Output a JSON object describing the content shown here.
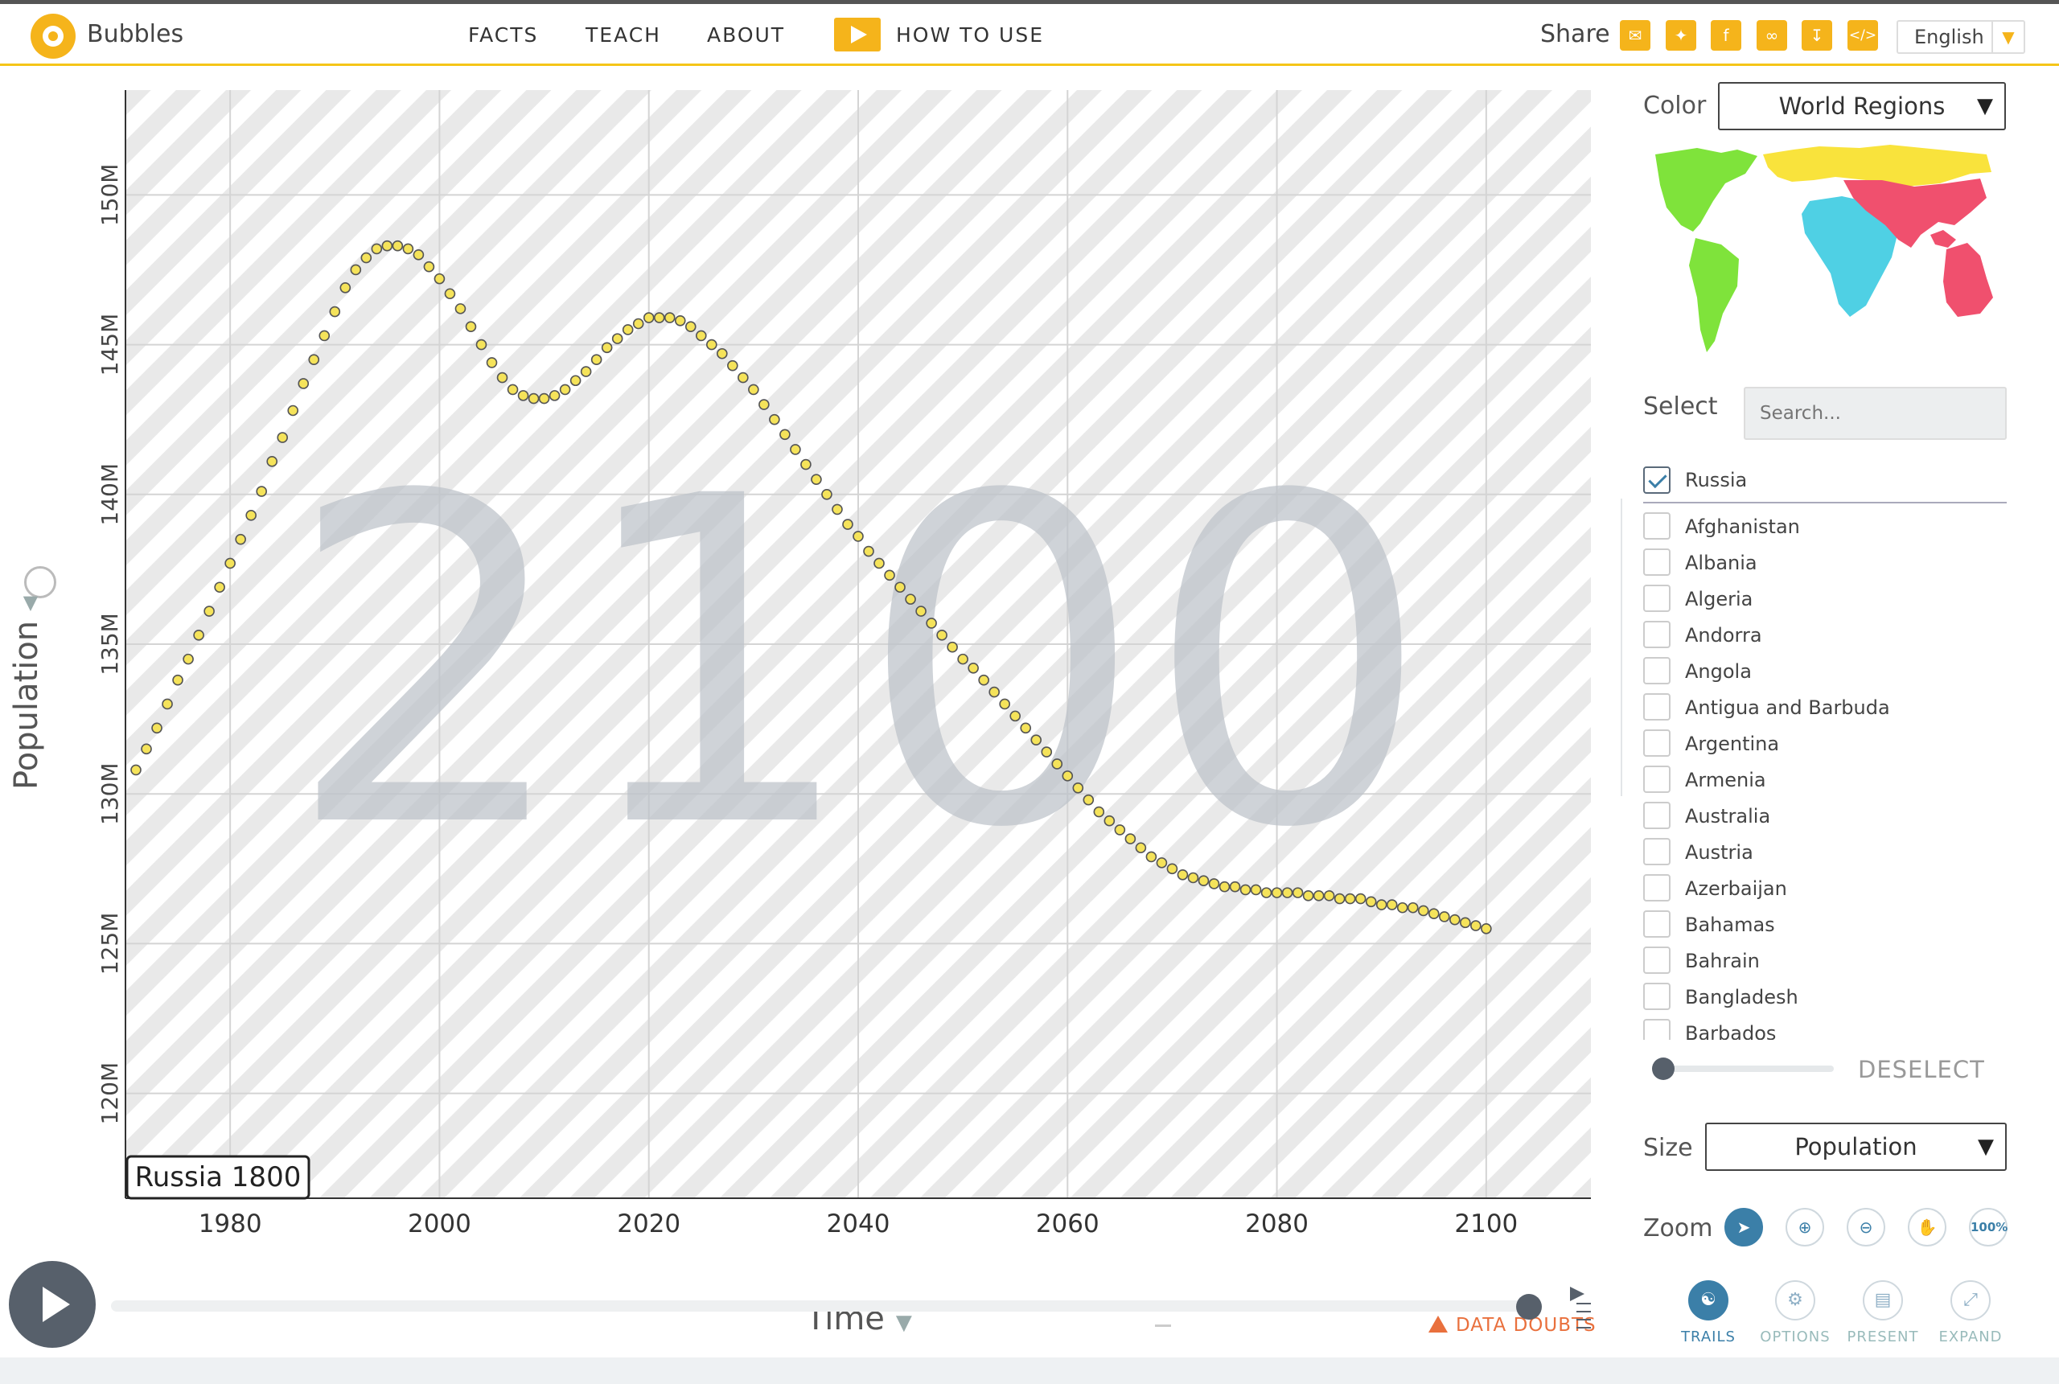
{
  "header": {
    "app_title": "Bubbles",
    "nav": [
      "FACTS",
      "TEACH",
      "ABOUT"
    ],
    "how_to_use": "HOW TO USE",
    "share_label": "Share",
    "share_icons": [
      "mail-icon",
      "twitter-icon",
      "facebook-icon",
      "link-icon",
      "download-icon",
      "embed-icon"
    ],
    "language": "English"
  },
  "chart": {
    "y_axis_label": "Population",
    "x_axis_label": "Time",
    "year_watermark": "2100",
    "tooltip_label": "Russia 1800",
    "data_doubts": "DATA DOUBTS"
  },
  "chart_data": {
    "type": "scatter",
    "title": "",
    "xlabel": "Time",
    "ylabel": "Population",
    "xlim": [
      1970,
      2110
    ],
    "ylim": [
      116500000,
      153500000
    ],
    "x_ticks": [
      1980,
      2000,
      2020,
      2040,
      2060,
      2080,
      2100
    ],
    "x_tick_labels": [
      "1980",
      "2000",
      "2020",
      "2040",
      "2060",
      "2080",
      "2100"
    ],
    "y_ticks": [
      120000000,
      125000000,
      130000000,
      135000000,
      140000000,
      145000000,
      150000000
    ],
    "y_tick_labels": [
      "120M",
      "125M",
      "130M",
      "135M",
      "140M",
      "145M",
      "150M"
    ],
    "grid": true,
    "series": [
      {
        "name": "Russia",
        "color": "#f5e35a",
        "stroke": "#555555",
        "x": [
          1971,
          1972,
          1973,
          1974,
          1975,
          1976,
          1977,
          1978,
          1979,
          1980,
          1981,
          1982,
          1983,
          1984,
          1985,
          1986,
          1987,
          1988,
          1989,
          1990,
          1991,
          1992,
          1993,
          1994,
          1995,
          1996,
          1997,
          1998,
          1999,
          2000,
          2001,
          2002,
          2003,
          2004,
          2005,
          2006,
          2007,
          2008,
          2009,
          2010,
          2011,
          2012,
          2013,
          2014,
          2015,
          2016,
          2017,
          2018,
          2019,
          2020,
          2021,
          2022,
          2023,
          2024,
          2025,
          2026,
          2027,
          2028,
          2029,
          2030,
          2031,
          2032,
          2033,
          2034,
          2035,
          2036,
          2037,
          2038,
          2039,
          2040,
          2041,
          2042,
          2043,
          2044,
          2045,
          2046,
          2047,
          2048,
          2049,
          2050,
          2051,
          2052,
          2053,
          2054,
          2055,
          2056,
          2057,
          2058,
          2059,
          2060,
          2061,
          2062,
          2063,
          2064,
          2065,
          2066,
          2067,
          2068,
          2069,
          2070,
          2071,
          2072,
          2073,
          2074,
          2075,
          2076,
          2077,
          2078,
          2079,
          2080,
          2081,
          2082,
          2083,
          2084,
          2085,
          2086,
          2087,
          2088,
          2089,
          2090,
          2091,
          2092,
          2093,
          2094,
          2095,
          2096,
          2097,
          2098,
          2099,
          2100
        ],
        "y": [
          130800000,
          131500000,
          132200000,
          133000000,
          133800000,
          134500000,
          135300000,
          136100000,
          136900000,
          137700000,
          138500000,
          139300000,
          140100000,
          141100000,
          141900000,
          142800000,
          143700000,
          144500000,
          145300000,
          146100000,
          146900000,
          147500000,
          147900000,
          148200000,
          148300000,
          148300000,
          148200000,
          148000000,
          147600000,
          147200000,
          146700000,
          146200000,
          145600000,
          145000000,
          144400000,
          143900000,
          143500000,
          143300000,
          143200000,
          143200000,
          143300000,
          143500000,
          143800000,
          144100000,
          144500000,
          144900000,
          145200000,
          145500000,
          145700000,
          145900000,
          145900000,
          145900000,
          145800000,
          145600000,
          145300000,
          145000000,
          144700000,
          144300000,
          143900000,
          143500000,
          143000000,
          142500000,
          142000000,
          141500000,
          141000000,
          140500000,
          140000000,
          139500000,
          139000000,
          138600000,
          138100000,
          137700000,
          137300000,
          136900000,
          136500000,
          136100000,
          135700000,
          135300000,
          134900000,
          134500000,
          134200000,
          133800000,
          133400000,
          133000000,
          132600000,
          132200000,
          131800000,
          131400000,
          131000000,
          130600000,
          130200000,
          129800000,
          129400000,
          129100000,
          128800000,
          128500000,
          128200000,
          127900000,
          127700000,
          127500000,
          127300000,
          127200000,
          127100000,
          127000000,
          126900000,
          126900000,
          126800000,
          126800000,
          126700000,
          126700000,
          126700000,
          126700000,
          126600000,
          126600000,
          126600000,
          126500000,
          126500000,
          126500000,
          126400000,
          126300000,
          126300000,
          126200000,
          126200000,
          126100000,
          126000000,
          125900000,
          125800000,
          125700000,
          125600000,
          125500000
        ]
      }
    ]
  },
  "timeline": {
    "play": "play-icon"
  },
  "panel": {
    "color_label": "Color",
    "color_value": "World Regions",
    "map_colors": {
      "americas": "#7fe33b",
      "europe_n_asia": "#f9e33c",
      "africa": "#4fd0e4",
      "asia_south": "#f0506e",
      "oceania": "#f0506e"
    },
    "select_label": "Select",
    "search_placeholder": "Search...",
    "selected": "Russia",
    "countries": [
      "Afghanistan",
      "Albania",
      "Algeria",
      "Andorra",
      "Angola",
      "Antigua and Barbuda",
      "Argentina",
      "Armenia",
      "Australia",
      "Austria",
      "Azerbaijan",
      "Bahamas",
      "Bahrain",
      "Bangladesh",
      "Barbados"
    ],
    "deselect": "DESELECT",
    "size_label": "Size",
    "size_value": "Population",
    "zoom_label": "Zoom",
    "zoom_100": "100%",
    "tools": [
      "TRAILS",
      "OPTIONS",
      "PRESENT",
      "EXPAND"
    ]
  }
}
